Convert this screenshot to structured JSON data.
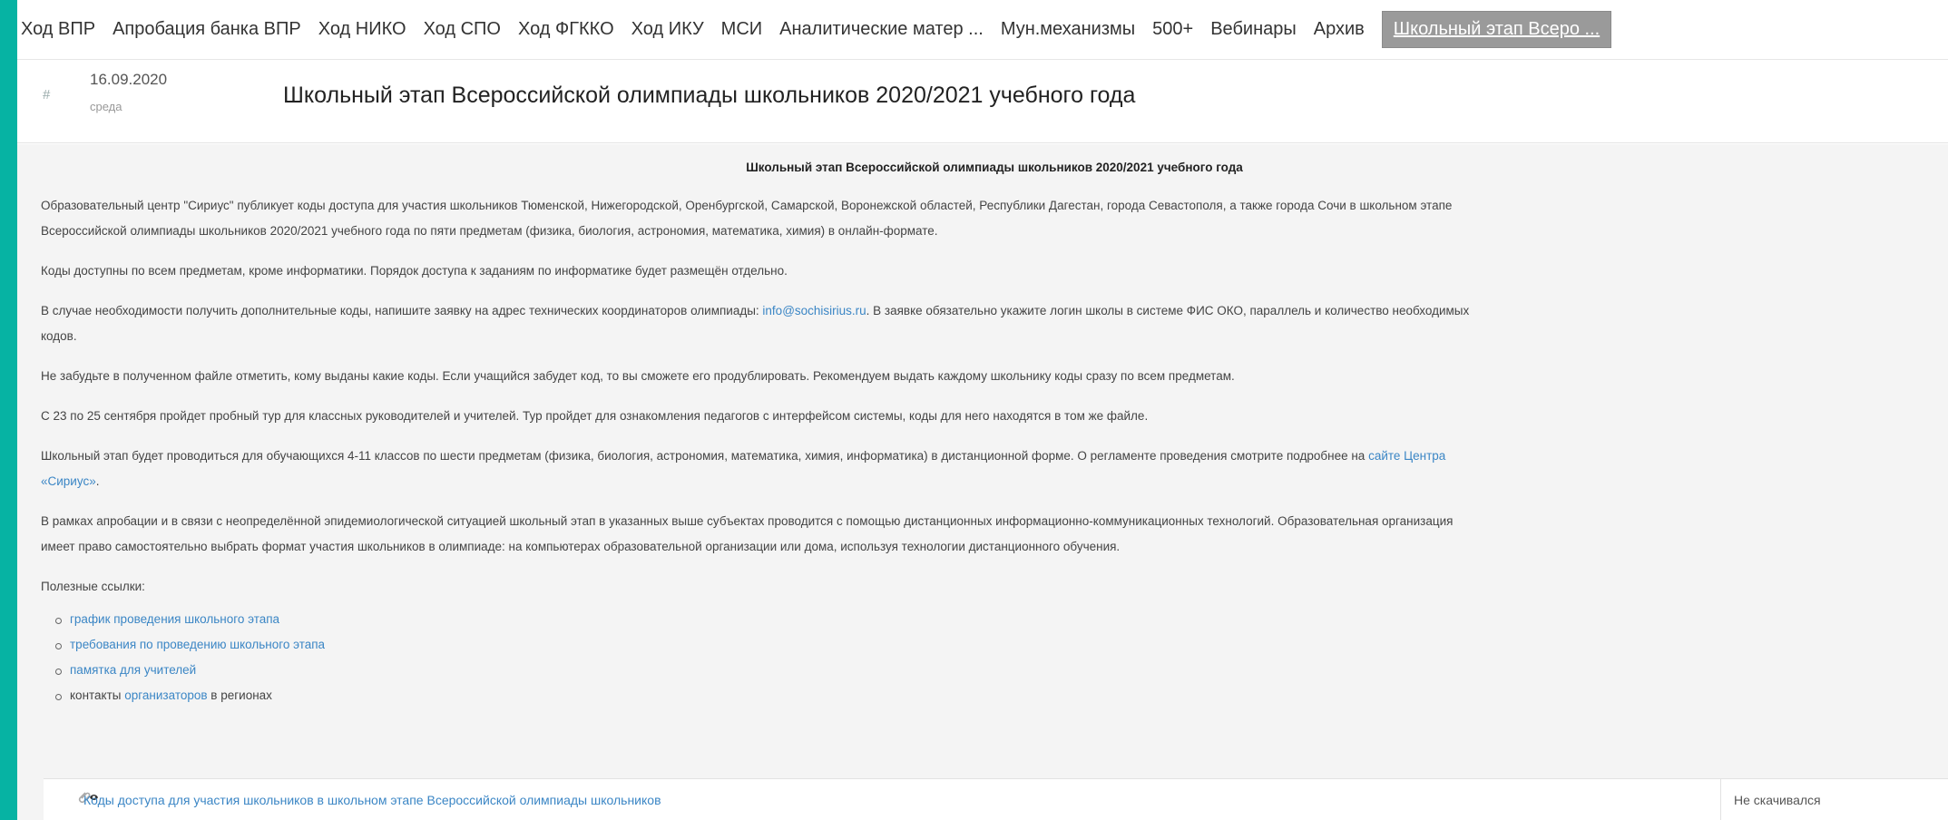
{
  "nav": {
    "items": [
      {
        "label": "Ход ВПР"
      },
      {
        "label": "Апробация банка ВПР"
      },
      {
        "label": "Ход НИКО"
      },
      {
        "label": "Ход СПО"
      },
      {
        "label": "Ход ФГККО"
      },
      {
        "label": "Ход ИКУ"
      },
      {
        "label": "МСИ"
      },
      {
        "label": "Аналитические матер ..."
      },
      {
        "label": "Мун.механизмы"
      },
      {
        "label": "500+"
      },
      {
        "label": "Вебинары"
      },
      {
        "label": "Архив"
      },
      {
        "label": "Школьный этап Всеро ..."
      }
    ]
  },
  "post": {
    "hash": "#",
    "date": "16.09.2020",
    "weekday": "среда",
    "title": "Школьный этап Всероссийской олимпиады школьников 2020/2021 учебного года"
  },
  "content": {
    "title": "Школьный этап Всероссийской олимпиады школьников 2020/2021 учебного года",
    "p1a": "Образовательный центр \"Сириус\" публикует коды доступа для участия школьников Тюменской, Нижегородской, Оренбургской, Самарской, Воронежской областей, Республики Дагестан, города Севастополя, а также города Сочи в школьном этапе",
    "p1b": "Всероссийской олимпиады школьников 2020/2021 учебного года по пяти предметам (физика, биология, астрономия, математика, химия) в онлайн-формате.",
    "p2": "Коды доступны по всем предметам, кроме информатики. Порядок доступа к заданиям по информатике будет размещён отдельно.",
    "p3a": "В случае необходимости получить дополнительные коды, напишите заявку на адрес технических координаторов олимпиады: ",
    "p3_email": "info@sochisirius.ru",
    "p3b": ". В заявке обязательно укажите логин школы в системе ФИС ОКО, параллель и количество необходимых",
    "p3c": "кодов.",
    "p4": "Не забудьте в полученном файле отметить, кому выданы какие коды. Если учащийся забудет код, то вы сможете его продублировать. Рекомендуем выдать каждому школьнику коды сразу по всем предметам.",
    "p5": "С 23 по 25 сентября пройдет пробный тур для классных руководителей и учителей. Тур пройдет для ознакомления педагогов с интерфейсом системы, коды для него находятся в том же файле.",
    "p6a": "Школьный этап будет проводиться для обучающихся 4-11 классов по шести предметам (физика, биология, астрономия, математика, химия, информатика) в дистанционной форме. О регламенте проведения смотрите подробнее на ",
    "p6_link1": "сайте Центра",
    "p6_link2": "«Сириус»",
    "p6b": ".",
    "p7a": "В рамках апробации и в связи с неопределённой эпидемиологической ситуацией школьный этап в указанных выше субъектах проводится с помощью дистанционных информационно-коммуникационных технологий. Образовательная организация",
    "p7b": "имеет право самостоятельно выбрать формат участия школьников в олимпиаде: на компьютерах образовательной организации или дома, используя технологии дистанционного обучения.",
    "links_title": "Полезные ссылки:",
    "links": [
      {
        "label": "график проведения школьного этапа"
      },
      {
        "label": "требования по проведению школьного этапа"
      },
      {
        "label": "памятка для учителей"
      }
    ],
    "link4_prefix": "контакты ",
    "link4_link": "организаторов",
    "link4_suffix": " в регионах"
  },
  "attachment": {
    "label": "Коды доступа для участия школьников в школьном этапе Всероссийской олимпиады школьников",
    "status": "Не скачивался"
  },
  "colors": {
    "accent": "#06b3a3",
    "link": "#3b86c5",
    "active_tab_bg": "#9a9a9a"
  }
}
